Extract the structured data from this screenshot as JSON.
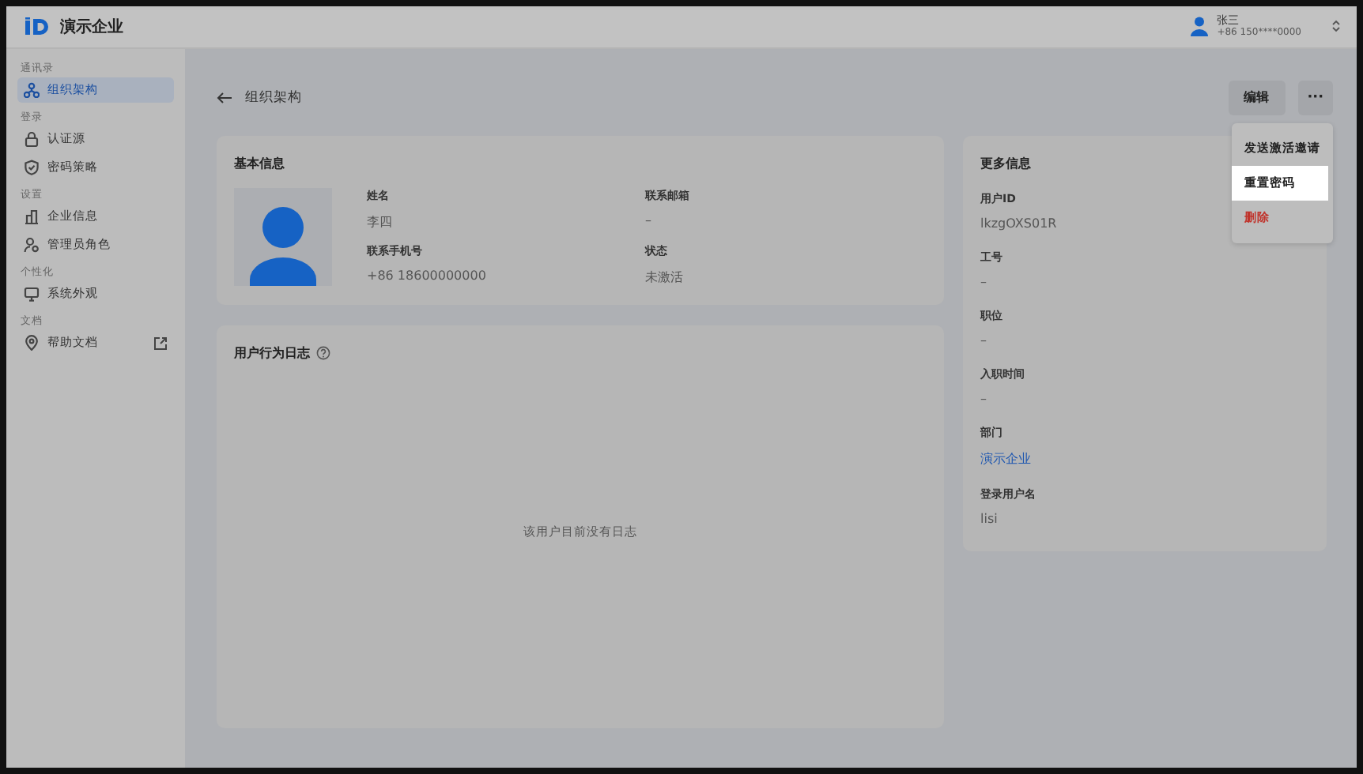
{
  "app": {
    "name": "演示企业"
  },
  "user": {
    "name": "张三",
    "phone": "+86 150****0000"
  },
  "sidebar": {
    "sections": [
      {
        "title": "通讯录",
        "items": [
          {
            "label": "组织架构",
            "selected": true
          }
        ]
      },
      {
        "title": "登录",
        "items": [
          {
            "label": "认证源",
            "selected": false
          },
          {
            "label": "密码策略",
            "selected": false
          }
        ]
      },
      {
        "title": "设置",
        "items": [
          {
            "label": "企业信息",
            "selected": false
          },
          {
            "label": "管理员角色",
            "selected": false
          }
        ]
      },
      {
        "title": "个性化",
        "items": [
          {
            "label": "系统外观",
            "selected": false
          }
        ]
      },
      {
        "title": "文档",
        "items": [
          {
            "label": "帮助文档",
            "selected": false,
            "external": true
          }
        ]
      }
    ]
  },
  "page": {
    "title": "组织架构",
    "edit_button": "编辑",
    "more_button": "···"
  },
  "menu": [
    {
      "label": "发送激活邀请",
      "kind": "normal",
      "selected": false
    },
    {
      "label": "重置密码",
      "kind": "normal",
      "selected": true
    },
    {
      "label": "删除",
      "kind": "danger",
      "selected": false
    }
  ],
  "basic_info": {
    "title": "基本信息",
    "fields": [
      {
        "label": "姓名",
        "value": "李四"
      },
      {
        "label": "联系邮箱",
        "value": "–"
      },
      {
        "label": "联系手机号",
        "value": "+86 18600000000"
      },
      {
        "label": "状态",
        "value": "未激活"
      }
    ]
  },
  "log": {
    "title": "用户行为日志",
    "empty": "该用户目前没有日志"
  },
  "more_info": {
    "title": "更多信息",
    "fields": [
      {
        "label": "用户ID",
        "value": "lkzgOXS01R",
        "kind": "text"
      },
      {
        "label": "工号",
        "value": "–",
        "kind": "text"
      },
      {
        "label": "职位",
        "value": "–",
        "kind": "text"
      },
      {
        "label": "入职时间",
        "value": "–",
        "kind": "text"
      },
      {
        "label": "部门",
        "value": "演示企业",
        "kind": "link"
      },
      {
        "label": "登录用户名",
        "value": "lisi",
        "kind": "text"
      }
    ]
  }
}
